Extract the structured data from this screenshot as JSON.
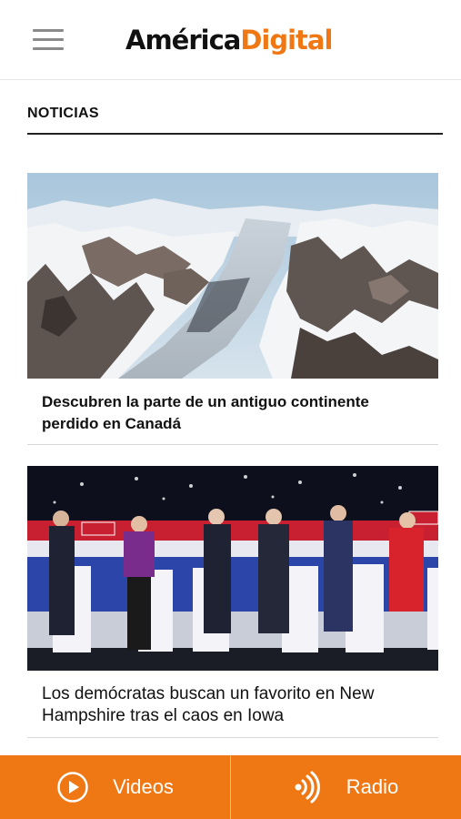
{
  "header": {
    "menu_icon": "hamburger-menu-icon",
    "logo_part1": "América",
    "logo_part2": "Digital",
    "brand_color": "#f07814"
  },
  "section": {
    "title": "NOTICIAS"
  },
  "articles": [
    {
      "image": "arctic-fjord-landscape-photo",
      "headline": "Descubren la parte de un antiguo continente perdido en Canadá"
    },
    {
      "image": "democratic-debate-stage-photo",
      "headline": "Los demócratas buscan un favorito en New Hampshire tras el caos en Iowa"
    }
  ],
  "bottom_nav": {
    "videos": {
      "label": "Videos",
      "icon": "play-circle-icon"
    },
    "radio": {
      "label": "Radio",
      "icon": "radio-waves-icon"
    }
  }
}
